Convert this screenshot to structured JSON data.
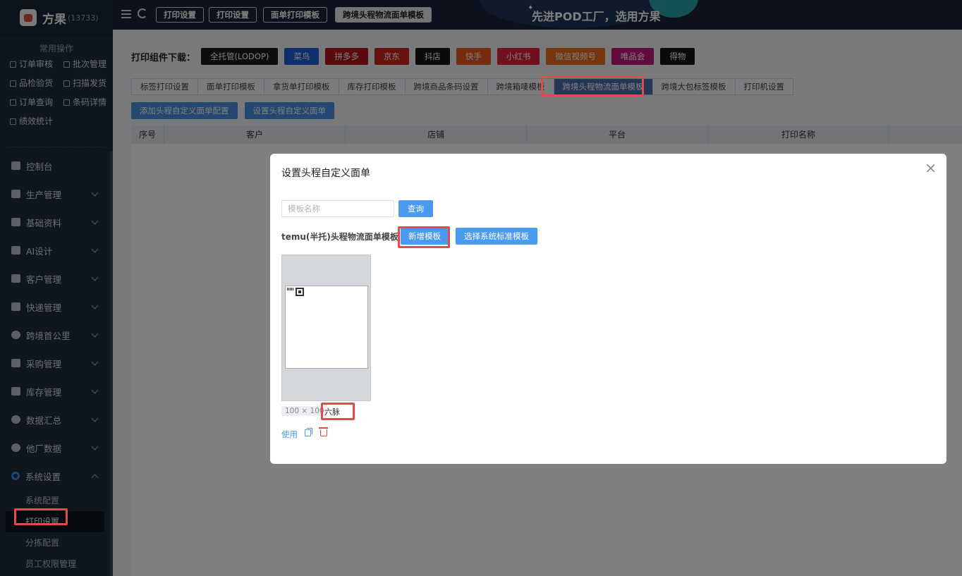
{
  "app": {
    "name": "方果",
    "account_count": "(13733)"
  },
  "sidebar": {
    "quick_title": "常用操作",
    "quick_items": [
      "订单审核",
      "批次管理",
      "品检验货",
      "扫描发货",
      "订单查询",
      "条码详情",
      "绩效统计"
    ],
    "menu": [
      {
        "label": "控制台",
        "icon": "dashboard-icon"
      },
      {
        "label": "生产管理",
        "icon": "production-icon"
      },
      {
        "label": "基础资料",
        "icon": "database-icon"
      },
      {
        "label": "AI设计",
        "icon": "ai-icon"
      },
      {
        "label": "客户管理",
        "icon": "users-icon"
      },
      {
        "label": "快递管理",
        "icon": "express-icon"
      },
      {
        "label": "跨境首公里",
        "icon": "globe-icon"
      },
      {
        "label": "采购管理",
        "icon": "purchase-icon"
      },
      {
        "label": "库存管理",
        "icon": "inventory-icon"
      },
      {
        "label": "数据汇总",
        "icon": "pie-chart-icon"
      },
      {
        "label": "他厂数据",
        "icon": "pie-chart-icon"
      },
      {
        "label": "系统设置",
        "icon": "settings-icon"
      }
    ],
    "submenu": [
      "系统配置",
      "打印设置",
      "分拣配置",
      "员工权限管理"
    ]
  },
  "topbar": {
    "tabs": [
      "打印设置",
      "打印设置",
      "面单打印模板",
      "跨境头程物流面单模板"
    ],
    "slogan": "先进POD工厂，选用方果"
  },
  "download": {
    "label": "打印组件下载：",
    "buttons": [
      {
        "label": "全托管(LODOP)",
        "color": "#1a1a1a"
      },
      {
        "label": "菜鸟",
        "color": "#1e5fd8"
      },
      {
        "label": "拼多多",
        "color": "#b5121b"
      },
      {
        "label": "京东",
        "color": "#d0241c"
      },
      {
        "label": "抖店",
        "color": "#151515"
      },
      {
        "label": "快手",
        "color": "#e8561c"
      },
      {
        "label": "小红书",
        "color": "#e2233f"
      },
      {
        "label": "微信视频号",
        "color": "#e86c1c"
      },
      {
        "label": "唯品会",
        "color": "#c8177d"
      },
      {
        "label": "得物",
        "color": "#141414"
      }
    ]
  },
  "subtabs": [
    "标签打印设置",
    "面单打印模板",
    "拿货单打印模板",
    "库存打印模板",
    "跨境商品条码设置",
    "跨境箱唛模板",
    "跨境头程物流面单模板",
    "跨境大包标签模板",
    "打印机设置"
  ],
  "actions": [
    "添加头程自定义面单配置",
    "设置头程自定义面单"
  ],
  "table": {
    "columns": [
      "序号",
      "客户",
      "店铺",
      "平台",
      "打印名称"
    ]
  },
  "modal": {
    "title": "设置头程自定义面单",
    "close": "×",
    "search_placeholder": "模板名称",
    "query_label": "查询",
    "section_label": "temu(半托)头程物流面单模板",
    "add_label": "新增模板",
    "system_label": "选择系统标准模板",
    "template": {
      "size": "100 × 100",
      "name": "六脉",
      "use_label": "使用"
    }
  }
}
